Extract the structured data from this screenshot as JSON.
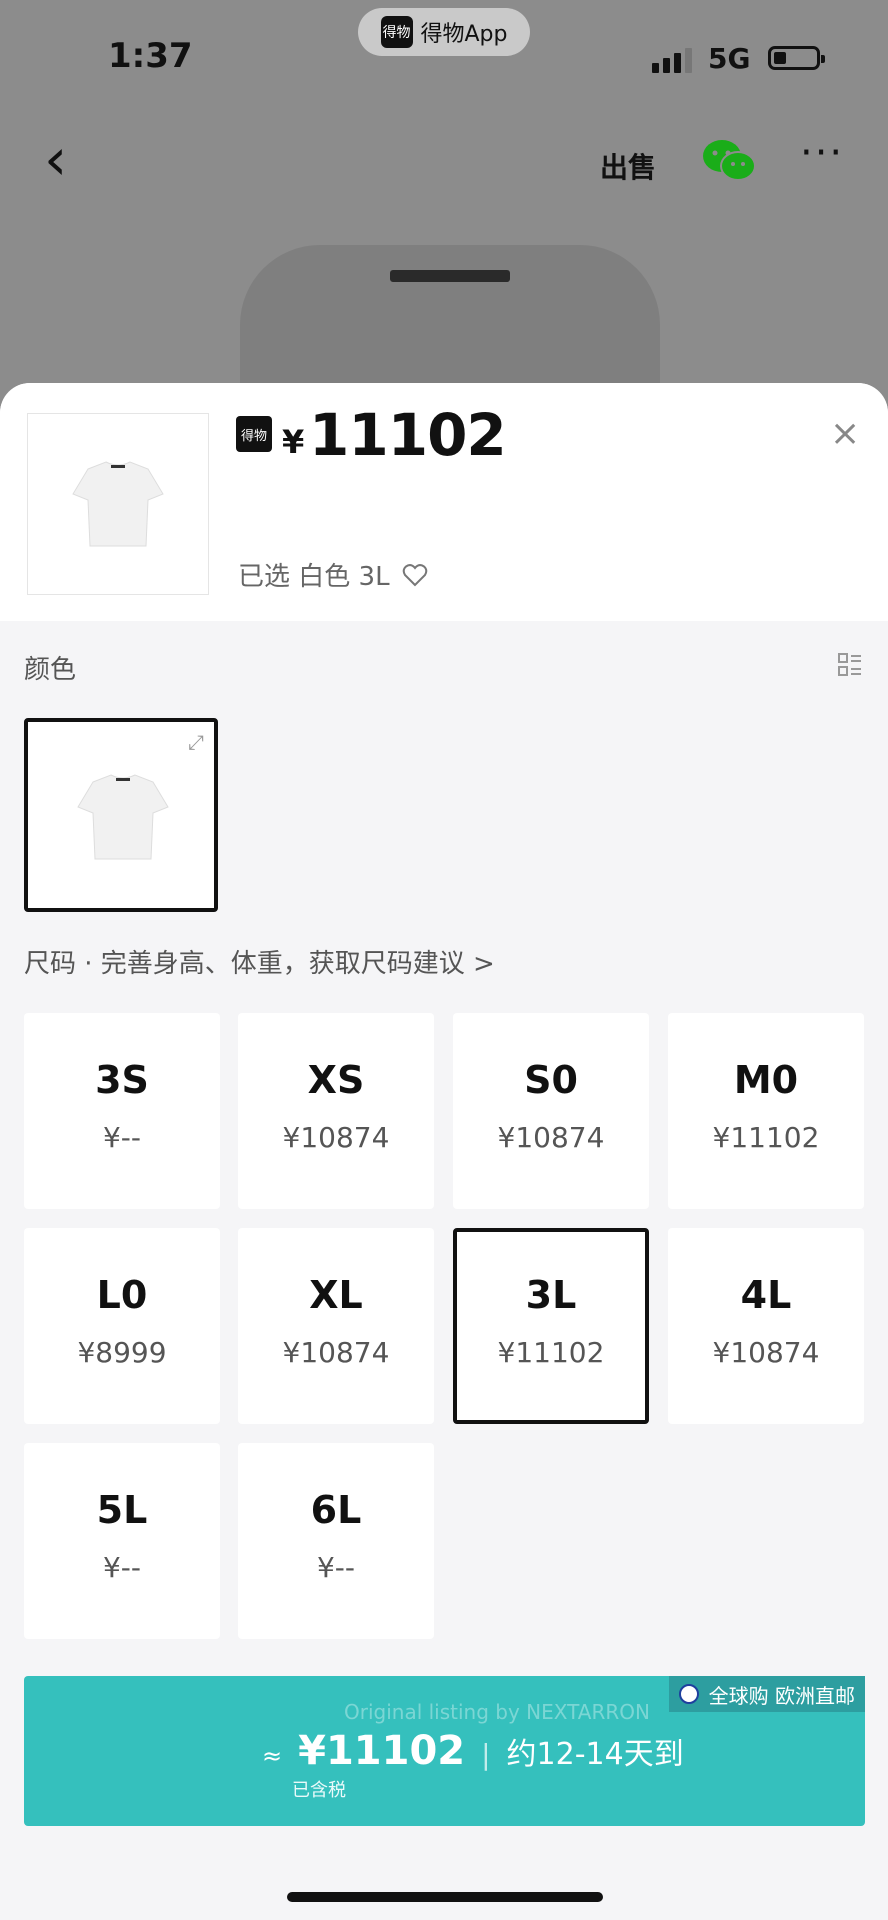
{
  "status_bar": {
    "time": "1:37",
    "app_pill_logo": "得物",
    "app_pill_text": "得物App",
    "network": "5G"
  },
  "nav": {
    "back_icon": "chevron-left",
    "sell_label": "出售",
    "wechat_icon": "wechat-icon",
    "more_label": "···"
  },
  "header": {
    "logo_text": "得物",
    "currency": "¥",
    "price": "11102",
    "selected_text": "已选 白色 3L",
    "close_icon": "×"
  },
  "color_section": {
    "label": "颜色"
  },
  "size_section": {
    "label": "尺码 · 完善身高、体重，获取尺码建议 >",
    "sizes": [
      {
        "name": "3S",
        "price": "¥--"
      },
      {
        "name": "XS",
        "price": "¥10874"
      },
      {
        "name": "S0",
        "price": "¥10874"
      },
      {
        "name": "M0",
        "price": "¥11102"
      },
      {
        "name": "L0",
        "price": "¥8999"
      },
      {
        "name": "XL",
        "price": "¥10874"
      },
      {
        "name": "3L",
        "price": "¥11102"
      },
      {
        "name": "4L",
        "price": "¥10874"
      },
      {
        "name": "5L",
        "price": "¥--"
      },
      {
        "name": "6L",
        "price": "¥--"
      }
    ]
  },
  "buy_bar": {
    "badge": "全球购 欧洲直邮",
    "approx": "≈",
    "price": "¥11102",
    "separator": "|",
    "delivery": "约12-14天到",
    "tax": "已含税",
    "watermark": "Original listing by NEXTARRON"
  }
}
